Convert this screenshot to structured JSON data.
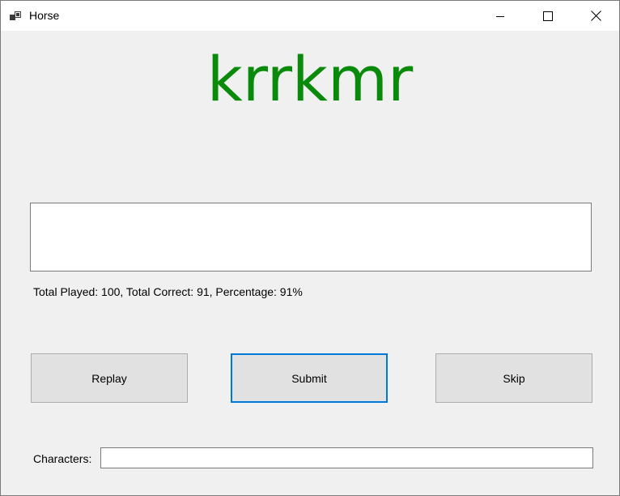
{
  "window": {
    "title": "Horse",
    "icon": "app-window-icon",
    "controls": [
      "minimize-icon",
      "maximize-icon",
      "close-icon"
    ]
  },
  "main": {
    "display_word": "krrkmr",
    "display_word_color": "#0a8a0a",
    "answer_value": "",
    "stats_text": "Total Played: 100, Total Correct: 91, Percentage: 91%"
  },
  "buttons": {
    "replay_label": "Replay",
    "submit_label": "Submit",
    "skip_label": "Skip"
  },
  "characters": {
    "label": "Characters:",
    "value": ""
  },
  "colors": {
    "focus_accent": "#0078d7"
  }
}
